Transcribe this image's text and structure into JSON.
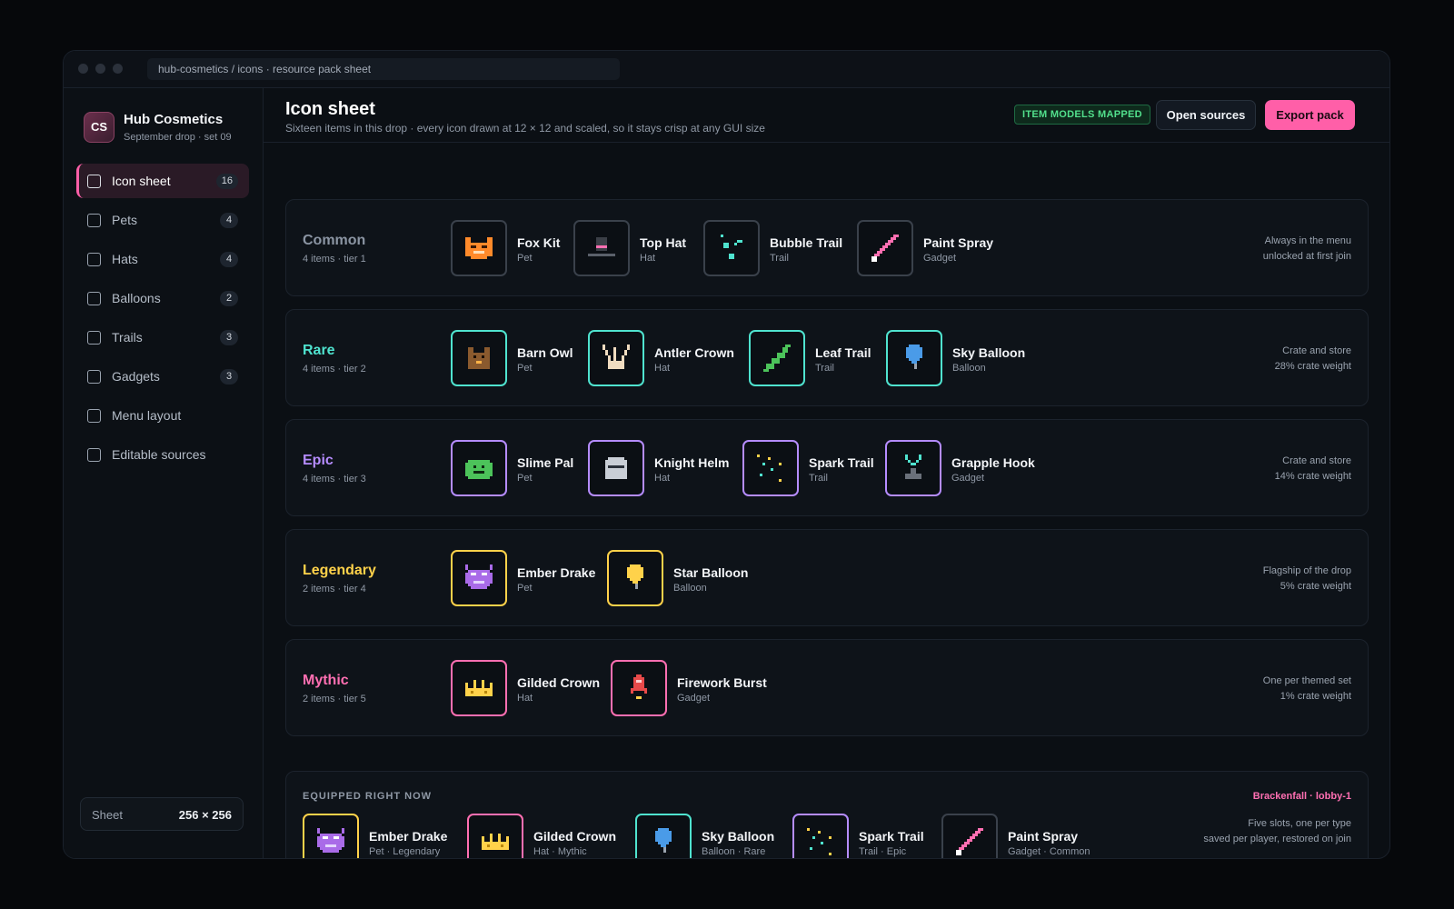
{
  "window": {
    "url": "hub-cosmetics / icons · resource pack sheet"
  },
  "brand": {
    "logo": "CS",
    "name": "Hub Cosmetics",
    "sub": "September drop · set 09"
  },
  "nav": [
    {
      "label": "Icon sheet",
      "count": "16"
    },
    {
      "label": "Pets",
      "count": "4"
    },
    {
      "label": "Hats",
      "count": "4"
    },
    {
      "label": "Balloons",
      "count": "2"
    },
    {
      "label": "Trails",
      "count": "3"
    },
    {
      "label": "Gadgets",
      "count": "3"
    },
    {
      "label": "Menu layout",
      "count": ""
    },
    {
      "label": "Editable sources",
      "count": ""
    }
  ],
  "sheet": {
    "label": "Sheet",
    "size": "256 × 256"
  },
  "header": {
    "title": "Icon sheet",
    "subtitle": "Sixteen items in this drop · every icon drawn at 12 × 12 and scaled, so it stays crisp at any GUI size",
    "badge": "ITEM MODELS MAPPED",
    "open_sources": "Open sources",
    "export": "Export pack"
  },
  "colors": {
    "common": "#8b95a3",
    "rare": "#4fe3cf",
    "epic": "#b58cff",
    "legendary": "#ffd24a",
    "mythic": "#ff6fb2",
    "accent": "#ff5fa8"
  },
  "tiers": [
    {
      "name": "Common",
      "meta": "4 items · tier 1",
      "note1": "Always in the menu",
      "note2": "unlocked at first join",
      "items": [
        {
          "name": "Fox Kit",
          "type": "Pet",
          "icon": "fox-icon"
        },
        {
          "name": "Top Hat",
          "type": "Hat",
          "icon": "top-hat-icon"
        },
        {
          "name": "Bubble Trail",
          "type": "Trail",
          "icon": "bubble-trail-icon"
        },
        {
          "name": "Paint Spray",
          "type": "Gadget",
          "icon": "paint-spray-icon"
        }
      ]
    },
    {
      "name": "Rare",
      "meta": "4 items · tier 2",
      "note1": "Crate and store",
      "note2": "28% crate weight",
      "items": [
        {
          "name": "Barn Owl",
          "type": "Pet",
          "icon": "owl-icon"
        },
        {
          "name": "Antler Crown",
          "type": "Hat",
          "icon": "antler-icon"
        },
        {
          "name": "Leaf Trail",
          "type": "Trail",
          "icon": "leaf-icon"
        },
        {
          "name": "Sky Balloon",
          "type": "Balloon",
          "icon": "balloon-icon"
        }
      ]
    },
    {
      "name": "Epic",
      "meta": "4 items · tier 3",
      "note1": "Crate and store",
      "note2": "14% crate weight",
      "items": [
        {
          "name": "Slime Pal",
          "type": "Pet",
          "icon": "slime-icon"
        },
        {
          "name": "Knight Helm",
          "type": "Hat",
          "icon": "helm-icon"
        },
        {
          "name": "Spark Trail",
          "type": "Trail",
          "icon": "spark-icon"
        },
        {
          "name": "Grapple Hook",
          "type": "Gadget",
          "icon": "grapple-icon"
        }
      ]
    },
    {
      "name": "Legendary",
      "meta": "2 items · tier 4",
      "note1": "Flagship of the drop",
      "note2": "5% crate weight",
      "items": [
        {
          "name": "Ember Drake",
          "type": "Pet",
          "icon": "drake-icon"
        },
        {
          "name": "Star Balloon",
          "type": "Balloon",
          "icon": "star-balloon-icon"
        }
      ]
    },
    {
      "name": "Mythic",
      "meta": "2 items · tier 5",
      "note1": "One per themed set",
      "note2": "1% crate weight",
      "items": [
        {
          "name": "Gilded Crown",
          "type": "Hat",
          "icon": "crown-icon"
        },
        {
          "name": "Firework Burst",
          "type": "Gadget",
          "icon": "firework-icon"
        }
      ]
    }
  ],
  "equipped": {
    "title": "EQUIPPED RIGHT NOW",
    "server": "Brackenfall · lobby-1",
    "note1": "Five slots, one per type",
    "note2": "saved per player, restored on join",
    "items": [
      {
        "name": "Ember Drake",
        "type": "Pet · Legendary",
        "icon": "drake-icon"
      },
      {
        "name": "Gilded Crown",
        "type": "Hat · Mythic",
        "icon": "crown-icon"
      },
      {
        "name": "Sky Balloon",
        "type": "Balloon · Rare",
        "icon": "balloon-icon"
      },
      {
        "name": "Spark Trail",
        "type": "Trail · Epic",
        "icon": "spark-icon"
      },
      {
        "name": "Paint Spray",
        "type": "Gadget · Common",
        "icon": "paint-spray-icon"
      }
    ]
  }
}
